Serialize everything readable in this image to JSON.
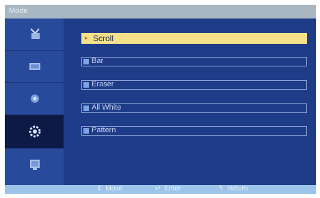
{
  "title": "Mode",
  "sidebar": {
    "tabs": [
      {
        "icon": "antenna-icon",
        "active": false
      },
      {
        "icon": "picture-icon",
        "active": false
      },
      {
        "icon": "sound-icon",
        "active": false
      },
      {
        "icon": "settings-gear-icon",
        "active": true
      },
      {
        "icon": "multi-screen-icon",
        "active": false
      }
    ]
  },
  "menu": {
    "items": [
      {
        "label": "Scroll",
        "selected": true
      },
      {
        "label": "Bar",
        "selected": false
      },
      {
        "label": "Eraser",
        "selected": false
      },
      {
        "label": "All White",
        "selected": false
      },
      {
        "label": "Pattern",
        "selected": false
      }
    ],
    "selected_marker": "▸"
  },
  "statusbar": {
    "move": {
      "icon": "⇕",
      "label": "Move"
    },
    "enter": {
      "icon": "↵",
      "label": "Enter"
    },
    "return": {
      "icon": "↰",
      "label": "Return"
    }
  },
  "colors": {
    "frame": "#1f3c88",
    "sidebar": "#284a9a",
    "active_tab": "#0d1a45",
    "highlight": "#f6e08a",
    "titlebar": "#a9b7c3",
    "statusbar": "#9cc4ea"
  }
}
